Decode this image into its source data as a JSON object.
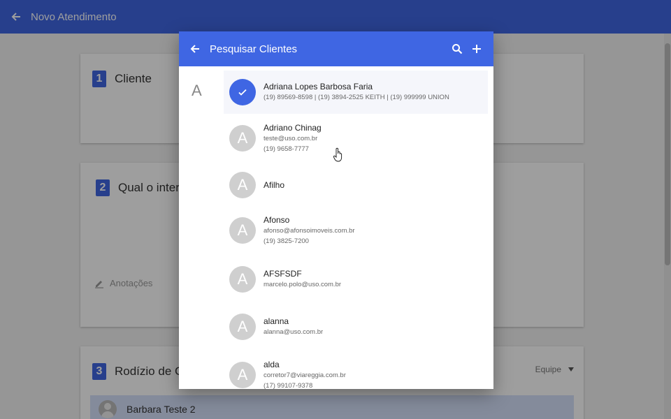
{
  "app": {
    "title": "Novo Atendimento"
  },
  "steps": [
    {
      "number": "1",
      "title": "Cliente"
    },
    {
      "number": "2",
      "title": "Qual o interes"
    },
    {
      "number": "3",
      "title": "Rodízio de Cor"
    }
  ],
  "annotations_label": "Anotações",
  "team_filter": {
    "label": "Equipe"
  },
  "selected_agent": {
    "name": "Barbara Teste 2"
  },
  "dialog": {
    "title": "Pesquisar Clientes",
    "section_letter": "A",
    "icons": {
      "back": "arrow-left-icon",
      "search": "search-icon",
      "add": "plus-icon"
    },
    "clients": [
      {
        "initial": "A",
        "selected": true,
        "name": "Adriana Lopes Barbosa Faria",
        "lines": [
          "(19) 89569-8598 | (19) 3894-2525 KEITH | (19) 999999 UNION"
        ]
      },
      {
        "initial": "A",
        "selected": false,
        "name": "Adriano Chinag",
        "lines": [
          "teste@uso.com.br",
          "(19) 9658-7777"
        ]
      },
      {
        "initial": "A",
        "selected": false,
        "name": "Afilho",
        "lines": []
      },
      {
        "initial": "A",
        "selected": false,
        "name": "Afonso",
        "lines": [
          "afonso@afonsoimoveis.com.br",
          "(19) 3825-7200"
        ]
      },
      {
        "initial": "A",
        "selected": false,
        "name": "AFSFSDF",
        "lines": [
          "marcelo.polo@uso.com.br"
        ]
      },
      {
        "initial": "A",
        "selected": false,
        "name": "alanna",
        "lines": [
          "alanna@uso.com.br"
        ]
      },
      {
        "initial": "A",
        "selected": false,
        "name": "alda",
        "lines": [
          "corretor7@viareggia.com.br",
          "(17) 99107-9378"
        ]
      }
    ]
  },
  "colors": {
    "primary": "#3f66e3",
    "avatar_gray": "#cfcfcf",
    "selected_row": "#d6e1fb"
  }
}
